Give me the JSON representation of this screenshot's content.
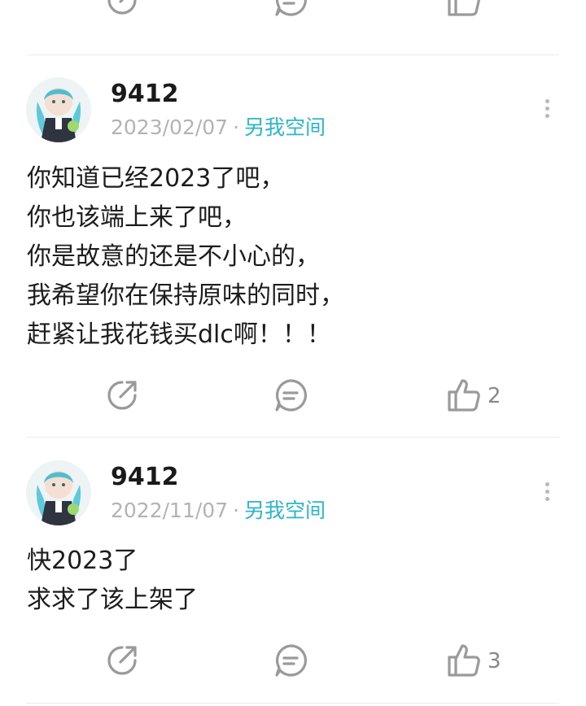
{
  "top_actions": {
    "share_icon": "share-icon",
    "comment_icon": "comment-icon",
    "like_icon": "like-icon"
  },
  "posts": [
    {
      "username": "9412",
      "date": "2023/02/07",
      "separator": "·",
      "space_link": "另我空间",
      "lines": [
        "你知道已经2023了吧，",
        "你也该端上来了吧，",
        "你是故意的还是不小心的，",
        "我希望你在保持原味的同时，",
        "赶紧让我花钱买dlc啊！！！"
      ],
      "likes": "2"
    },
    {
      "username": "9412",
      "date": "2022/11/07",
      "separator": "·",
      "space_link": "另我空间",
      "lines": [
        "快2023了",
        "求求了该上架了"
      ],
      "likes": "3"
    }
  ],
  "colors": {
    "accent": "#2ab7c9",
    "icon_gray": "#999999",
    "meta_gray": "#b3b3b3",
    "divider": "#ececec"
  }
}
